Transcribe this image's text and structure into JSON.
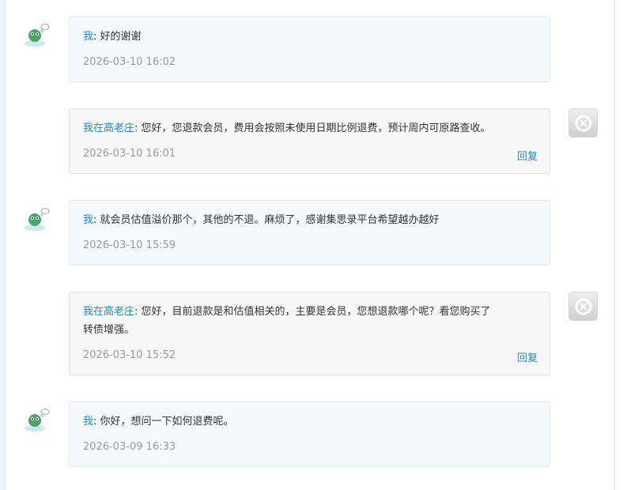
{
  "messages": [
    {
      "sender": "我",
      "text": "好的谢谢",
      "time": "2026-03-10 16:02",
      "mine": true
    },
    {
      "sender": "我在高老庄",
      "text": "您好，您退款会员，费用会按照未使用日期比例退费，预计周内可原路查收。",
      "time": "2026-03-10 16:01",
      "mine": false,
      "reply_label": "回复"
    },
    {
      "sender": "我",
      "text": "就会员估值溢价那个，其他的不退。麻烦了，感谢集思录平台希望越办越好",
      "time": "2026-03-10 15:59",
      "mine": true
    },
    {
      "sender": "我在高老庄",
      "text": "您好，目前退款是和估值相关的，主要是会员，您想退款哪个呢？看您购买了",
      "text_line2": "转债增强。",
      "time": "2026-03-10 15:52",
      "mine": false,
      "reply_label": "回复"
    },
    {
      "sender": "我",
      "text": "你好，想问一下如何退费呢。",
      "time": "2026-03-09 16:33",
      "mine": true
    }
  ],
  "separator": ": ",
  "icons": {
    "my_avatar": "frog-avatar-icon",
    "other_avatar": "default-avatar-icon"
  }
}
